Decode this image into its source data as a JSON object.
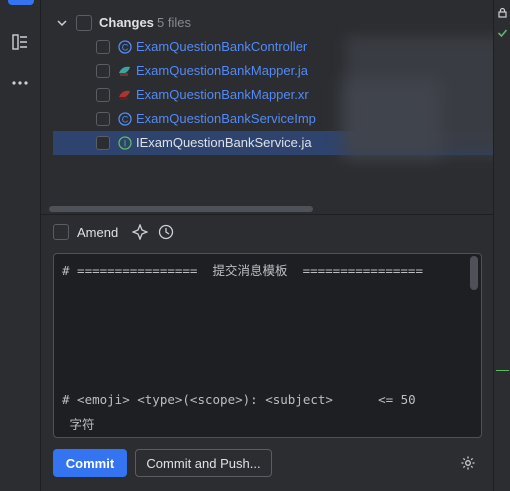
{
  "changes": {
    "title": "Changes",
    "count": "5 files",
    "files": [
      {
        "name": "ExamQuestionBankController",
        "icon": "java-class-icon"
      },
      {
        "name": "ExamQuestionBankMapper.ja",
        "icon": "mybatis-mapper-icon"
      },
      {
        "name": "ExamQuestionBankMapper.xr",
        "icon": "mybatis-xml-icon"
      },
      {
        "name": "ExamQuestionBankServiceImp",
        "icon": "java-class-icon"
      },
      {
        "name": "IExamQuestionBankService.ja",
        "icon": "java-interface-icon"
      }
    ]
  },
  "amend": {
    "label": "Amend"
  },
  "commit_message": {
    "lines": [
      "# ================  提交消息模板  ================",
      "# <emoji> <type>(<scope>): <subject>      <= 50",
      " 字符"
    ]
  },
  "buttons": {
    "commit": "Commit",
    "commit_push": "Commit and Push..."
  },
  "colors": {
    "accent": "#3574f0",
    "file_blue": "#548af7",
    "selection": "#2e436e",
    "panel": "#2b2d30"
  }
}
